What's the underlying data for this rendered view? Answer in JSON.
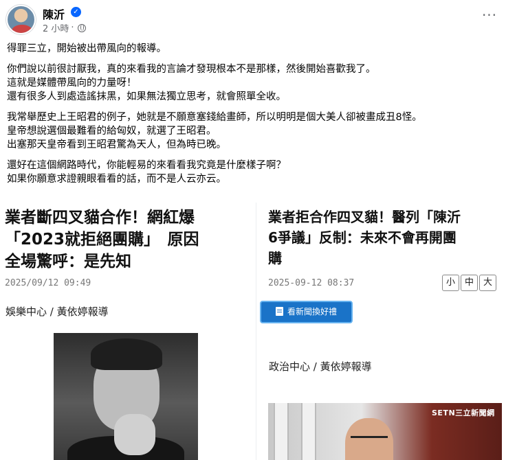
{
  "post": {
    "author": "陳沂",
    "time": "2 小時",
    "dot": "·",
    "more": "···",
    "verified_mark": "✓"
  },
  "body": {
    "p1": [
      "得罪三立，開始被出帶風向的報導。"
    ],
    "p2": [
      "你們說以前很討厭我，真的來看我的言論才發現根本不是那樣，然後開始喜歡我了。",
      "這就是媒體帶風向的力量呀！",
      "還有很多人到處造謠抹黑，如果無法獨立思考，就會照單全收。"
    ],
    "p3": [
      "我常舉歷史上王昭君的例子，她就是不願意塞錢給畫師，所以明明是個大美人卻被畫成丑8怪。",
      "皇帝想說選個最難看的給匈奴，就選了王昭君。",
      "出塞那天皇帝看到王昭君驚為天人，但為時已晚。"
    ],
    "p4": [
      "還好在這個網路時代，你能輕易的來看看我究竟是什麼樣子啊？",
      "如果你願意求證親眼看看的話，而不是人云亦云。"
    ]
  },
  "left_article": {
    "headline_lines": [
      "業者斷四叉貓合作！網紅爆",
      "「2023就拒絕團購」　原因",
      "全場驚呼：是先知"
    ],
    "date": "2025/09/12 09:49",
    "byline": "娛樂中心 / 黃依婷報導"
  },
  "right_article": {
    "headline_lines": [
      "業者拒合作四叉貓！醫列「陳沂",
      "6爭議」反制：未來不會再開團",
      "購"
    ],
    "date": "2025-09-12 08:37",
    "size_buttons": [
      "小",
      "中",
      "大"
    ],
    "gift_button": "看新聞換好禮",
    "byline": "政治中心 / 黃依婷報導",
    "photo_watermark": "SETN三立新聞網"
  },
  "icons": {
    "verified": "verified-badge-icon",
    "globe": "globe-icon",
    "more": "more-options-icon",
    "doc": "document-icon"
  },
  "colors": {
    "verified_blue": "#0866ff",
    "gift_button_bg": "#1a73c8",
    "meta_gray": "#65676b"
  }
}
